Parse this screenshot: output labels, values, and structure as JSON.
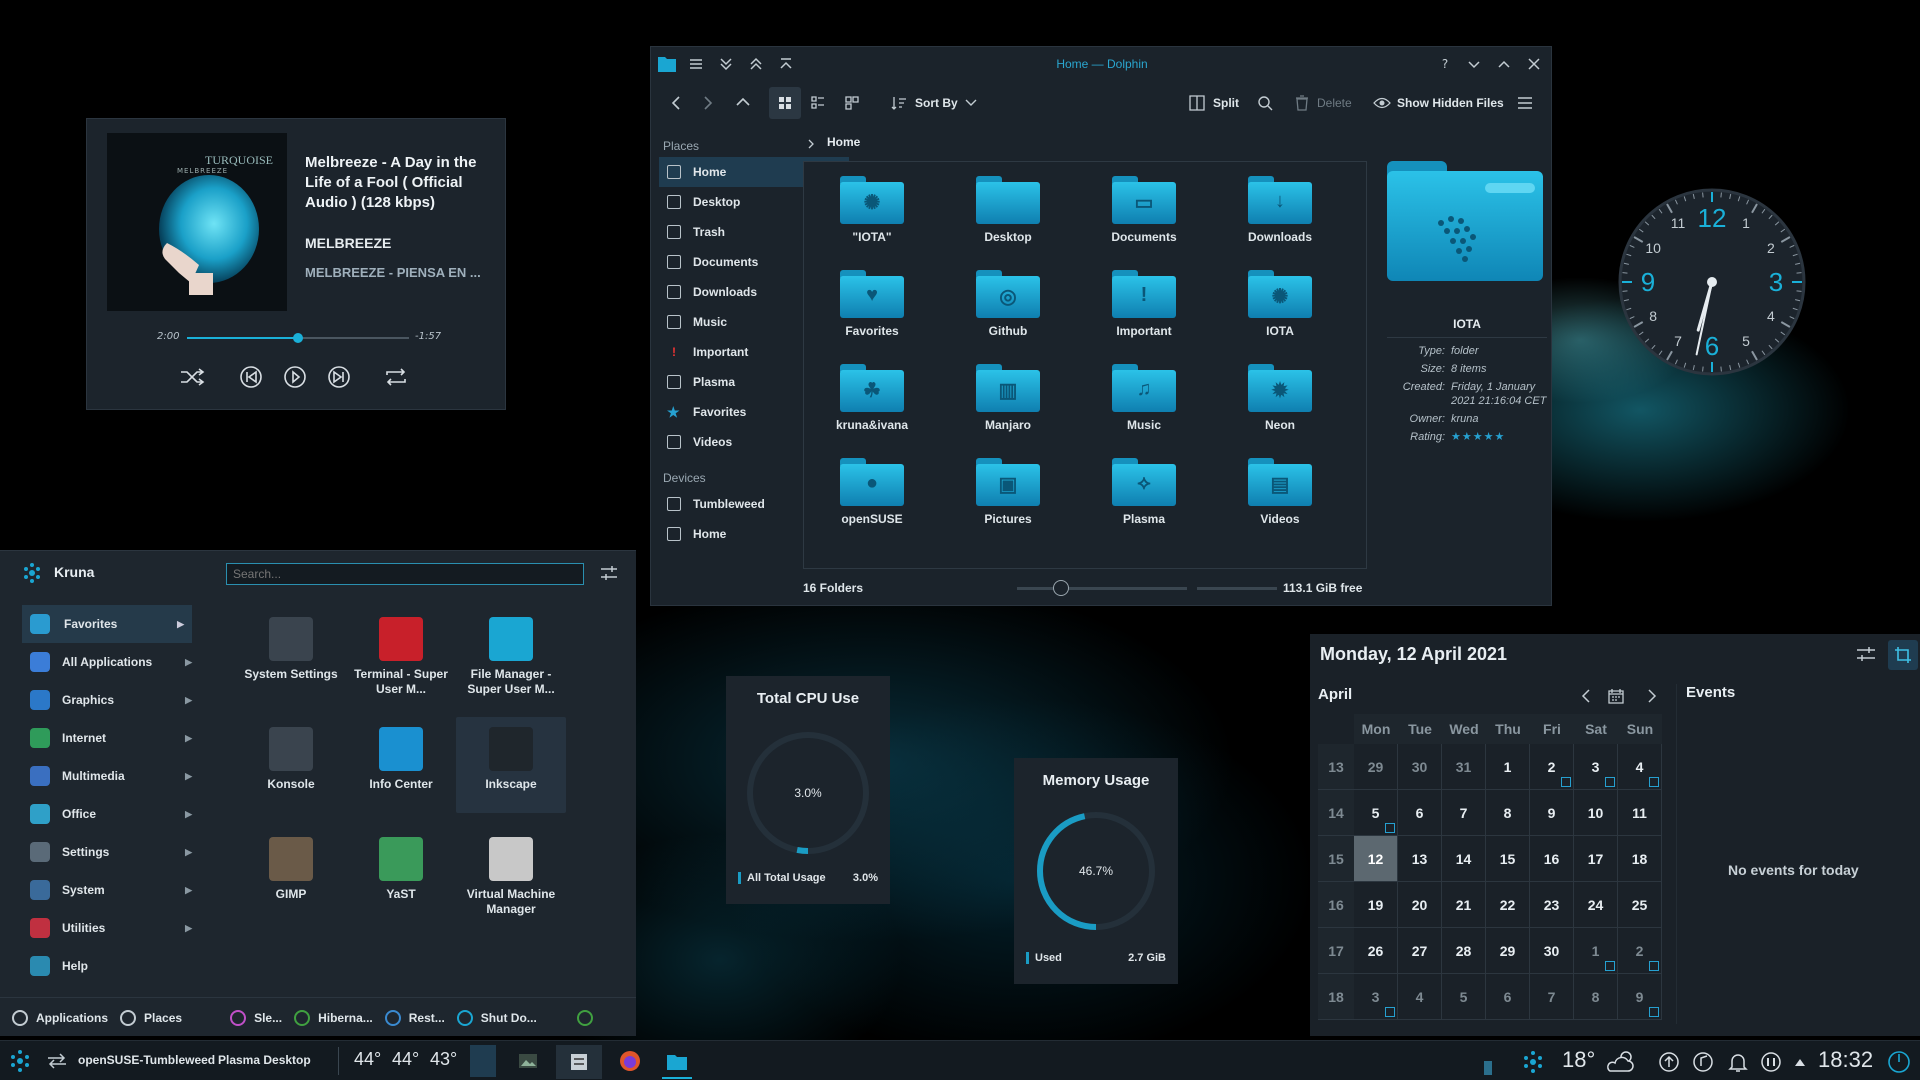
{
  "media": {
    "art_brand": "TURQUOISE",
    "art_sub": "MELBREEZE",
    "title": "Melbreeze - A Day in the Life of a Fool ( Official Audio ) (128 kbps)",
    "artist": "MELBREEZE",
    "album": "MELBREEZE - PIENSA EN ...",
    "elapsed": "2:00",
    "remaining": "-1:57",
    "progress": 0.5
  },
  "dolphin": {
    "window_title": "Home — Dolphin",
    "toolbar": {
      "sort_by": "Sort By",
      "split": "Split",
      "delete": "Delete",
      "show_hidden": "Show Hidden Files"
    },
    "places_header": "Places",
    "places": [
      "Home",
      "Desktop",
      "Trash",
      "Documents",
      "Downloads",
      "Music",
      "Important",
      "Plasma",
      "Favorites",
      "Videos"
    ],
    "devices_header": "Devices",
    "devices": [
      "Tumbleweed",
      "Home"
    ],
    "breadcrumb": "Home",
    "folders": [
      "\"IOTA\"",
      "Desktop",
      "Documents",
      "Downloads",
      "Favorites",
      "Github",
      "Important",
      "IOTA",
      "kruna&ivana",
      "Manjaro",
      "Music",
      "Neon",
      "openSUSE",
      "Pictures",
      "Plasma",
      "Videos"
    ],
    "info": {
      "name": "IOTA",
      "type_label": "Type:",
      "type": "folder",
      "size_label": "Size:",
      "size": "8 items",
      "created_label": "Created:",
      "created": "Friday, 1 January 2021 21:16:04 CET",
      "owner_label": "Owner:",
      "owner": "kruna",
      "rating_label": "Rating:",
      "rating": 5
    },
    "status_folders": "16 Folders",
    "status_free": "113.1 GiB free"
  },
  "clock": {
    "time": "18:32",
    "numbers": [
      "12",
      "1",
      "2",
      "3",
      "4",
      "5",
      "6",
      "7",
      "8",
      "9",
      "10",
      "11"
    ]
  },
  "cpu": {
    "title": "Total CPU Use",
    "value": "3.0%",
    "legend": "All Total Usage",
    "legend_value": "3.0%",
    "fraction": 0.03
  },
  "memory": {
    "title": "Memory Usage",
    "value": "46.7%",
    "legend": "Used",
    "legend_value": "2.7 GiB",
    "fraction": 0.467
  },
  "launcher": {
    "user": "Kruna",
    "search_placeholder": "Search...",
    "categories": [
      "Favorites",
      "All Applications",
      "Graphics",
      "Internet",
      "Multimedia",
      "Office",
      "Settings",
      "System",
      "Utilities",
      "Help"
    ],
    "apps": [
      "System Settings",
      "Terminal - Super User M...",
      "File Manager - Super User M...",
      "Konsole",
      "Info Center",
      "Inkscape",
      "GIMP",
      "YaST",
      "Virtual Machine Manager"
    ],
    "footer": [
      "Applications",
      "Places",
      "Sle...",
      "Hiberna...",
      "Rest...",
      "Shut Do..."
    ]
  },
  "calendar": {
    "date": "Monday, 12 April 2021",
    "month": "April",
    "events_header": "Events",
    "no_events": "No events for today",
    "weekdays": [
      "Mon",
      "Tue",
      "Wed",
      "Thu",
      "Fri",
      "Sat",
      "Sun"
    ],
    "weeks": [
      {
        "wk": "13",
        "days": [
          "29",
          "30",
          "31",
          "1",
          "2",
          "3",
          "4"
        ]
      },
      {
        "wk": "14",
        "days": [
          "5",
          "6",
          "7",
          "8",
          "9",
          "10",
          "11"
        ]
      },
      {
        "wk": "15",
        "days": [
          "12",
          "13",
          "14",
          "15",
          "16",
          "17",
          "18"
        ]
      },
      {
        "wk": "16",
        "days": [
          "19",
          "20",
          "21",
          "22",
          "23",
          "24",
          "25"
        ]
      },
      {
        "wk": "17",
        "days": [
          "26",
          "27",
          "28",
          "29",
          "30",
          "1",
          "2"
        ]
      },
      {
        "wk": "18",
        "days": [
          "3",
          "4",
          "5",
          "6",
          "7",
          "8",
          "9"
        ]
      }
    ]
  },
  "taskbar": {
    "desktop_name": "openSUSE-Tumbleweed",
    "activity": "Plasma Desktop",
    "temps": [
      "44°",
      "44°",
      "43°"
    ],
    "weather_temp": "18°",
    "time": "18:32"
  },
  "colors": {
    "accent": "#1ab0d8",
    "folder": "#1591bd",
    "panel": "#1b232b"
  }
}
